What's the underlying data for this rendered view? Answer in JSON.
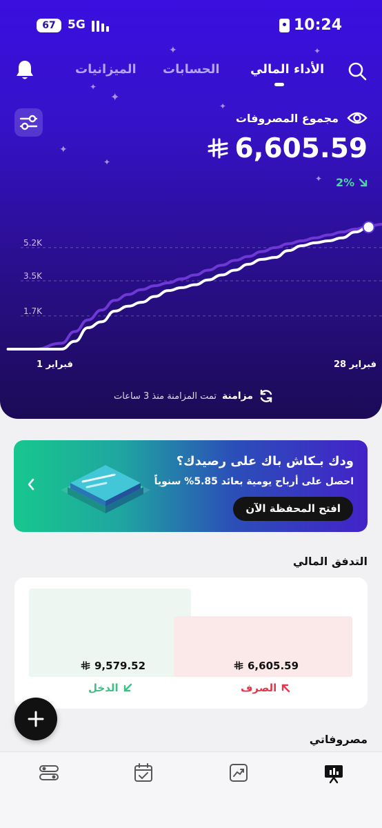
{
  "status_bar": {
    "battery": "67",
    "network": "5G",
    "time": "10:24"
  },
  "nav": {
    "tabs": [
      {
        "label": "الأداء المالي",
        "active": true
      },
      {
        "label": "الحسابات",
        "active": false
      },
      {
        "label": "الميزانيات",
        "active": false
      }
    ],
    "icons": [
      "search-icon",
      "bell-icon"
    ]
  },
  "summary": {
    "title": "مجموع المصروفات",
    "amount": "6,605.59",
    "change": "2%",
    "change_direction": "down",
    "visibility_icon": "eye-icon",
    "filter_icon": "sliders-icon"
  },
  "chart_data": {
    "type": "line",
    "yticks": [
      "5.2K",
      "3.5K",
      "1.7K"
    ],
    "x_start_label": "1 فبراير",
    "x_end_label": "28 فبراير",
    "series": [
      {
        "style": "current",
        "color": "#ffffff",
        "x": [
          1,
          3,
          5,
          6,
          7,
          8,
          9,
          10,
          11,
          12,
          13,
          14,
          15,
          16,
          17,
          18,
          19,
          20,
          21,
          22,
          23,
          24,
          25,
          26,
          27,
          28
        ],
        "y": [
          0,
          0,
          0,
          400,
          1100,
          1400,
          1950,
          2200,
          2400,
          2700,
          3000,
          3150,
          3300,
          3550,
          3800,
          4050,
          4350,
          4600,
          4700,
          5050,
          5300,
          5450,
          5550,
          5700,
          6000,
          6250
        ]
      },
      {
        "style": "previous",
        "color": "#6f38d6",
        "x": [
          1,
          3,
          5,
          6,
          7,
          8,
          9,
          10,
          11,
          12,
          13,
          14,
          15,
          16,
          17,
          18,
          19,
          20,
          21,
          22,
          23,
          24,
          25,
          26,
          27,
          28,
          29
        ],
        "y": [
          0,
          0,
          300,
          900,
          1500,
          2000,
          2500,
          2800,
          3050,
          3250,
          3400,
          3600,
          3800,
          4050,
          4300,
          4550,
          4750,
          5000,
          5200,
          5400,
          5550,
          5700,
          5850,
          6000,
          6150,
          6300,
          6400
        ]
      }
    ],
    "ylim": [
      0,
      7000
    ]
  },
  "sync": {
    "status": "تمت المزامنة منذ 3 ساعات",
    "action": "مزامنة"
  },
  "promo": {
    "title": "ودك بـكاش باك على رصيدك؟",
    "subtitle": "احصل على أرباح يومية بعائد  5.85% سنوياً",
    "cta": "افتح المحفظة الآن"
  },
  "cash_flow": {
    "title": "التدفق المالي",
    "income": {
      "label": "الدخل",
      "amount": "9,579.52",
      "color": "#3dbf86",
      "bar_color": "#edf6f1",
      "level": 1.0
    },
    "expense": {
      "label": "الصرف",
      "amount": "6,605.59",
      "color": "#e0394d",
      "bar_color": "#fbe8e9",
      "level": 0.69
    }
  },
  "expenses_section": {
    "title": "مصروفاتي"
  },
  "tab_bar": {
    "icons": [
      "sliders-tab-icon",
      "calendar-check-icon",
      "trend-chart-icon",
      "presentation-chart-icon"
    ],
    "active_index": 3
  }
}
